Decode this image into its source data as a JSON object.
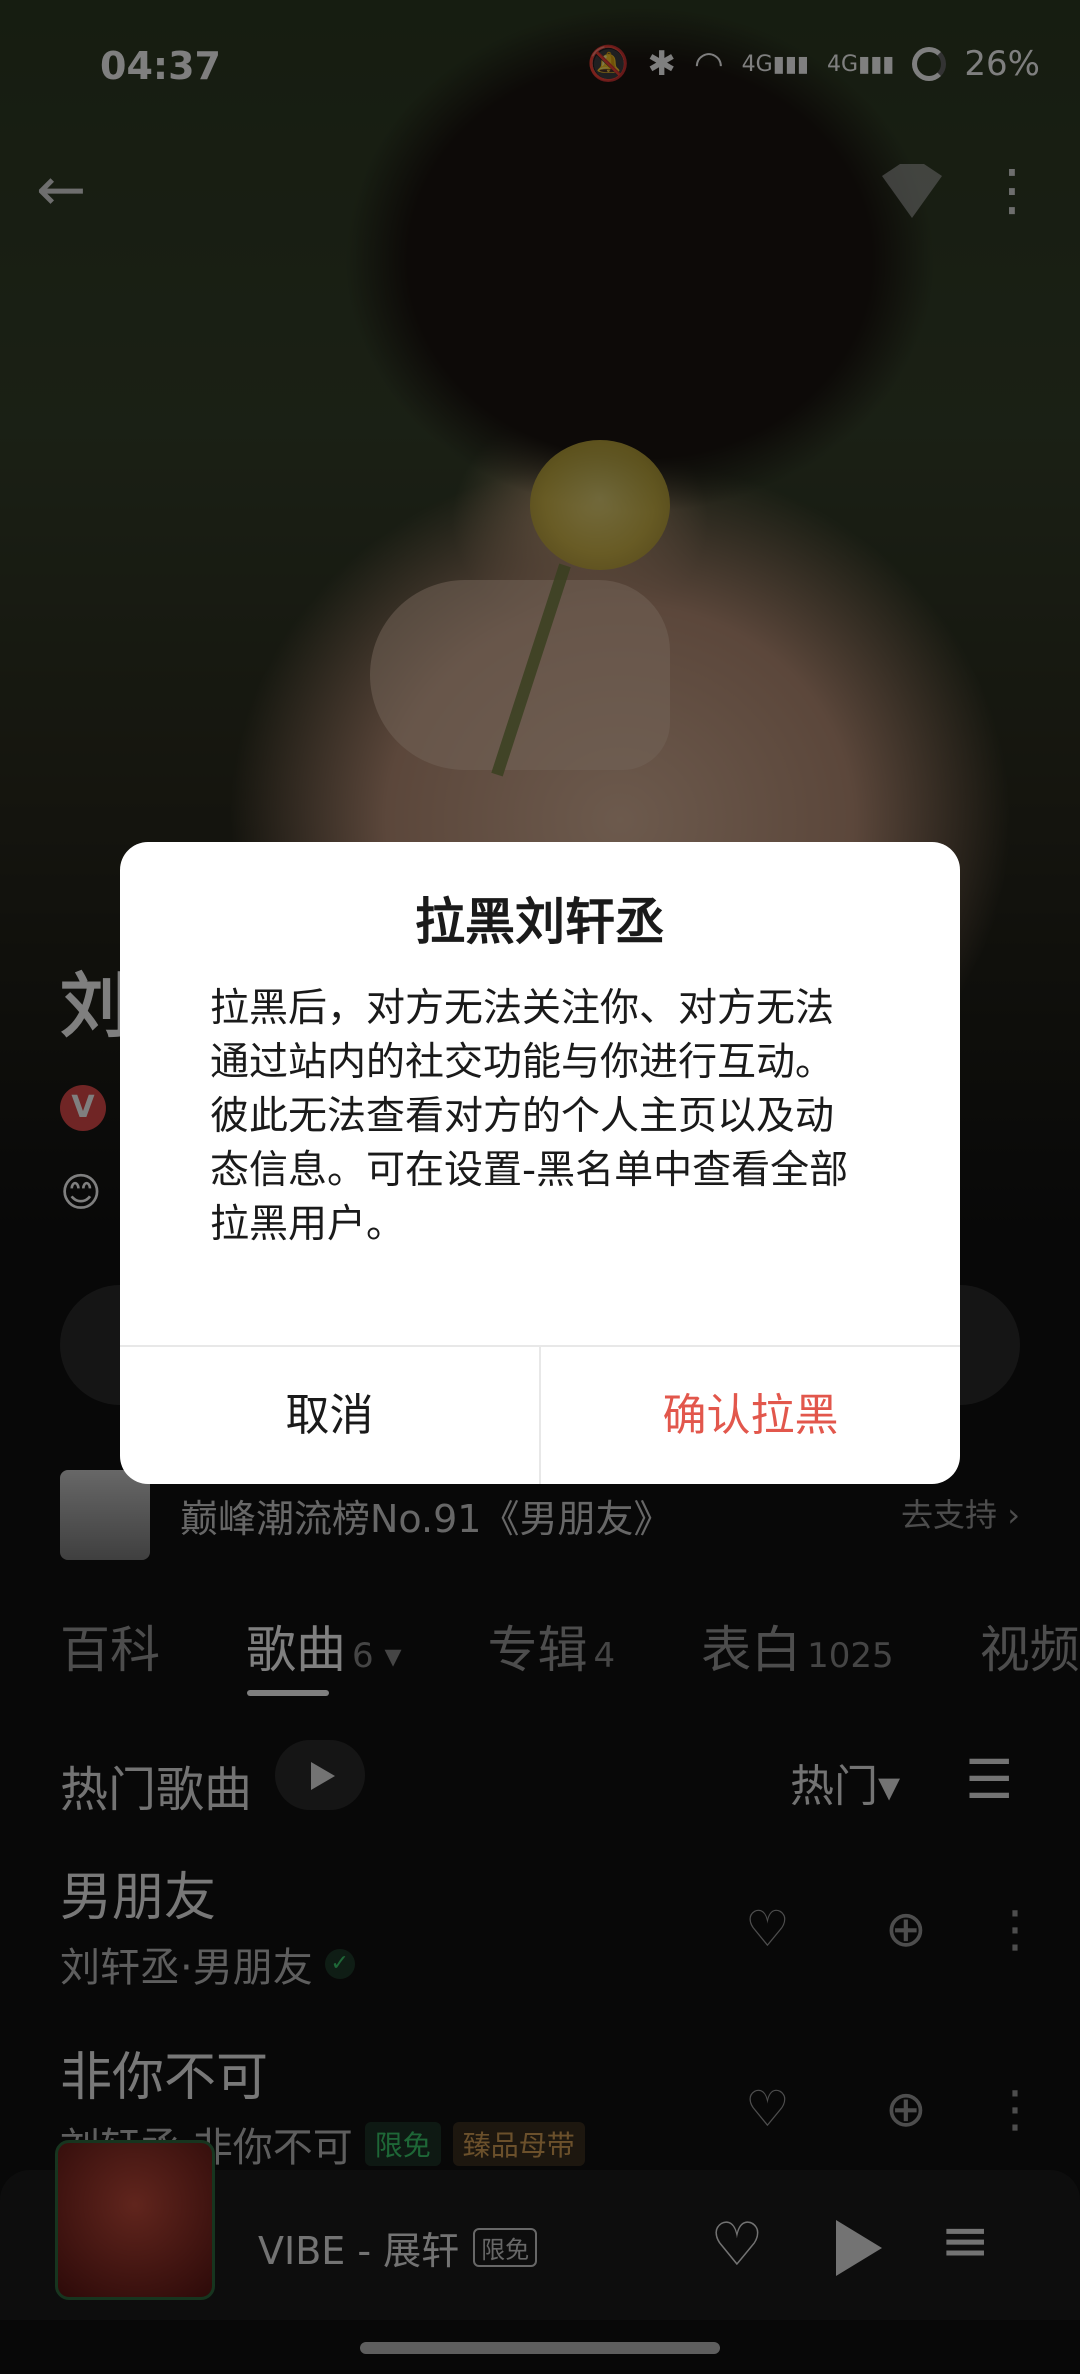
{
  "status_bar": {
    "time": "04:37",
    "network_1": "4G",
    "network_2": "4G",
    "battery": "26%"
  },
  "profile": {
    "name_visible": "刘",
    "verified_badge": "V",
    "emoji": "😊"
  },
  "banner": {
    "chart_text": "巅峰潮流榜No.91《男朋友》",
    "support_label": "去支持 ›"
  },
  "tabs": [
    {
      "label": "百科",
      "count": ""
    },
    {
      "label": "歌曲",
      "count": "6 ▾"
    },
    {
      "label": "专辑",
      "count": "4"
    },
    {
      "label": "表白",
      "count": "1025"
    },
    {
      "label": "视频",
      "count": ""
    }
  ],
  "hot_songs": {
    "title": "热门歌曲",
    "sort_label": "热门▾"
  },
  "songs": [
    {
      "title": "男朋友",
      "subtitle": "刘轩丞·男朋友",
      "tag_free": "",
      "tag_hq": ""
    },
    {
      "title": "非你不可",
      "subtitle": "刘轩丞·非你不可",
      "tag_free": "限免",
      "tag_hq": "臻品母带"
    }
  ],
  "player": {
    "track": "VIBE - 展轩",
    "badge": "限免"
  },
  "dialog": {
    "title": "拉黑刘轩丞",
    "body": "拉黑后，对方无法关注你、对方无法通过站内的社交功能与你进行互动。彼此无法查看对方的个人主页以及动态信息。可在设置-黑名单中查看全部拉黑用户。",
    "cancel": "取消",
    "confirm": "确认拉黑"
  },
  "colors": {
    "confirm_red": "#e2574c",
    "verified_red": "#e14a4a",
    "free_green": "#3ccf6e",
    "hq_gold": "#d6a157"
  }
}
